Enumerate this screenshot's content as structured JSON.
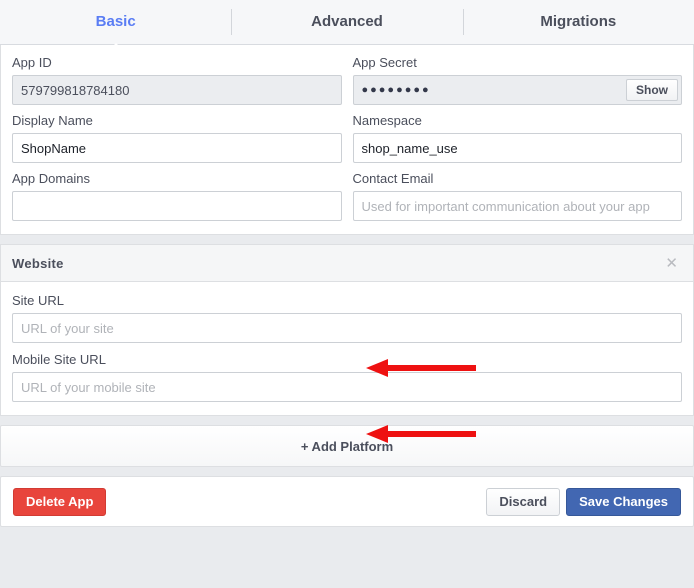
{
  "tabs": [
    {
      "label": "Basic",
      "active": true
    },
    {
      "label": "Advanced",
      "active": false
    },
    {
      "label": "Migrations",
      "active": false
    }
  ],
  "basic": {
    "app_id": {
      "label": "App ID",
      "value": "579799818784180",
      "readonly": true
    },
    "app_secret": {
      "label": "App Secret",
      "masked_value": "●●●●●●●●",
      "show_button": "Show"
    },
    "display_name": {
      "label": "Display Name",
      "value": "ShopName",
      "placeholder": ""
    },
    "namespace": {
      "label": "Namespace",
      "value": "shop_name_use",
      "placeholder": ""
    },
    "app_domains": {
      "label": "App Domains",
      "value": "",
      "placeholder": ""
    },
    "contact_email": {
      "label": "Contact Email",
      "value": "",
      "placeholder": "Used for important communication about your app"
    }
  },
  "website_section": {
    "title": "Website",
    "close_icon": "close-icon",
    "site_url": {
      "label": "Site URL",
      "value": "",
      "placeholder": "URL of your site"
    },
    "mobile_site_url": {
      "label": "Mobile Site URL",
      "value": "",
      "placeholder": "URL of your mobile site"
    }
  },
  "add_platform": {
    "label": "+ Add Platform"
  },
  "footer": {
    "delete_label": "Delete App",
    "discard_label": "Discard",
    "save_label": "Save Changes"
  },
  "annotations": {
    "arrow_color": "#ee1111",
    "arrows": [
      {
        "name": "arrow-site-url",
        "points_to": "site-url-input"
      },
      {
        "name": "arrow-mobile-site-url",
        "points_to": "mobile-site-url-input"
      }
    ]
  },
  "colors": {
    "accent_blue": "#5a7df4",
    "save_blue": "#4267b2",
    "delete_red": "#e8453c",
    "page_bg": "#e9ebee",
    "panel_bg": "#ffffff"
  }
}
